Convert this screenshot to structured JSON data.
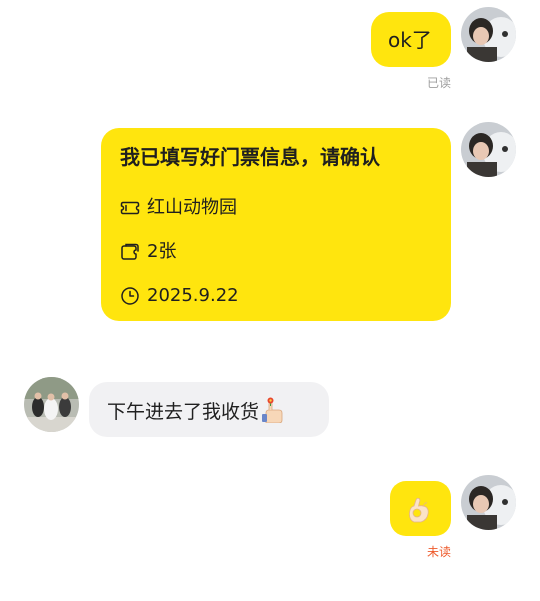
{
  "messages": [
    {
      "side": "right",
      "type": "text",
      "text": "ok了",
      "status": "已读"
    },
    {
      "side": "right",
      "type": "ticket_card",
      "title": "我已填写好门票信息，请确认",
      "rows": [
        {
          "icon": "ticket-icon",
          "text": "红山动物园"
        },
        {
          "icon": "ticket-count-icon",
          "text": "2张"
        },
        {
          "icon": "clock-icon",
          "text": "2025.9.22"
        }
      ]
    },
    {
      "side": "left",
      "type": "text",
      "text": "下午进去了我收货",
      "emoji": "flower-hand-emoji"
    },
    {
      "side": "right",
      "type": "emoji",
      "emoji": "ok-hand-emoji",
      "status": "未读"
    }
  ],
  "colors": {
    "bubble_self": "#ffe50e",
    "bubble_other": "#f1f1f3",
    "status_read": "#9e9e9e",
    "status_unread": "#ee5a2b"
  }
}
